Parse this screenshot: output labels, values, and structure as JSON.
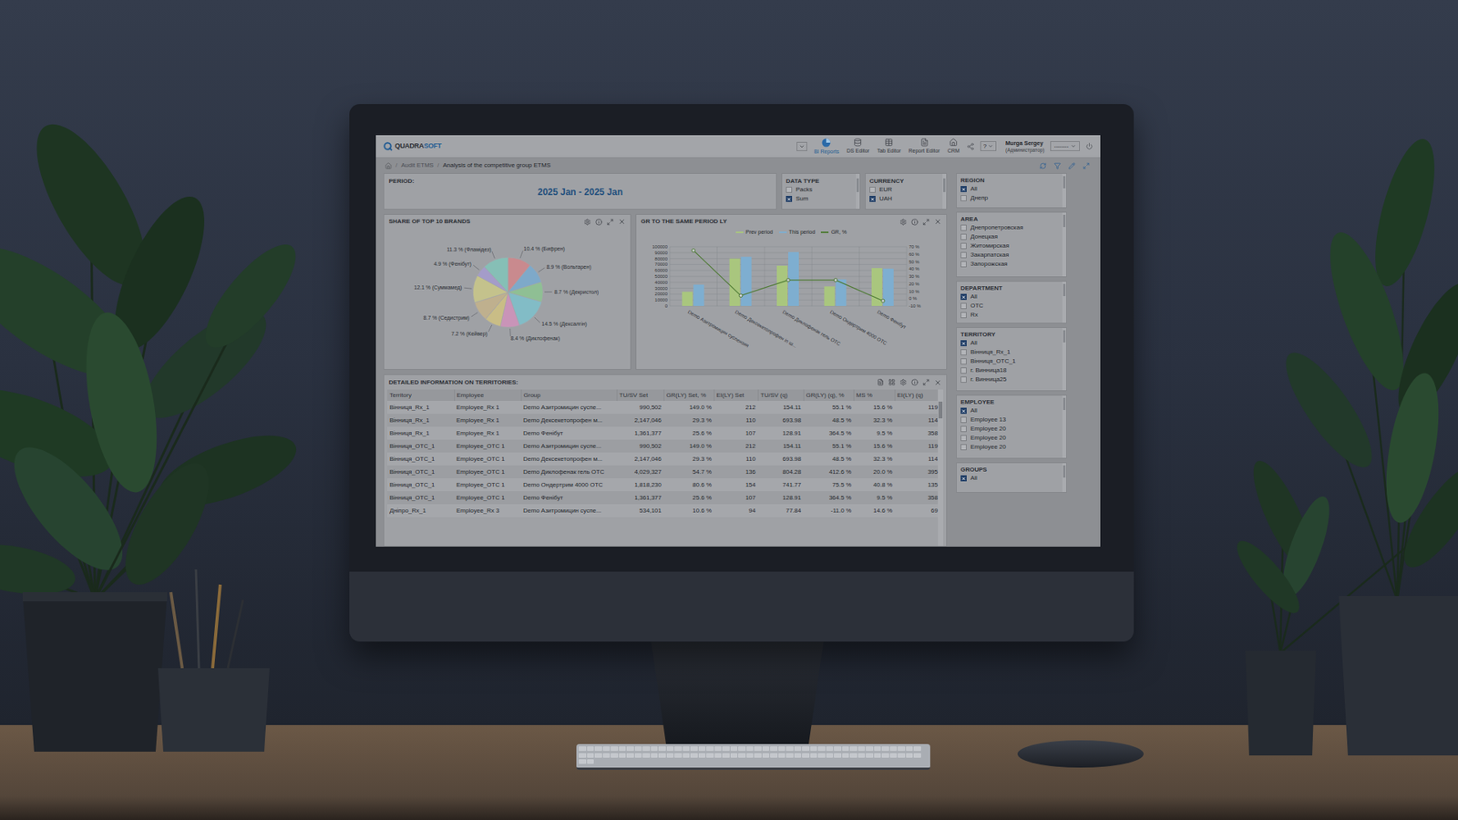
{
  "app": {
    "logo_main": "QUADRA",
    "logo_accent": "SOFT",
    "nav": [
      {
        "label": "BI Reports",
        "selected": true
      },
      {
        "label": "DS Editor",
        "selected": false
      },
      {
        "label": "Tab Editor",
        "selected": false
      },
      {
        "label": "Report Editor",
        "selected": false
      },
      {
        "label": "CRM",
        "selected": false
      }
    ],
    "help": "?",
    "user": {
      "name": "Murga Sergey",
      "role": "(Администратор)"
    },
    "user_select": "--------"
  },
  "breadcrumb": [
    "Audit ETMS",
    "Analysis of the competitive group ETMS"
  ],
  "period": {
    "label": "PERIOD:",
    "value": "2025 Jan - 2025 Jan"
  },
  "data_type": {
    "title": "DATA TYPE",
    "options": [
      {
        "label": "Packs",
        "checked": false
      },
      {
        "label": "Sum",
        "checked": true
      }
    ]
  },
  "currency": {
    "title": "CURRENCY",
    "options": [
      {
        "label": "EUR",
        "checked": false
      },
      {
        "label": "UAH",
        "checked": true
      }
    ]
  },
  "filters": [
    {
      "title": "REGION",
      "items": [
        {
          "label": "All",
          "checked": true
        },
        {
          "label": "Днепр",
          "checked": false
        }
      ]
    },
    {
      "title": "AREA",
      "items": [
        {
          "label": "Днепропетровская",
          "checked": false
        },
        {
          "label": "Донецкая",
          "checked": false
        },
        {
          "label": "Житомирская",
          "checked": false
        },
        {
          "label": "Закарпатская",
          "checked": false
        },
        {
          "label": "Запорожская",
          "checked": false
        }
      ]
    },
    {
      "title": "DEPARTMENT",
      "items": [
        {
          "label": "All",
          "checked": true
        },
        {
          "label": "OTC",
          "checked": false
        },
        {
          "label": "Rx",
          "checked": false
        }
      ]
    },
    {
      "title": "TERRITORY",
      "items": [
        {
          "label": "All",
          "checked": true
        },
        {
          "label": "Вінниця_Rx_1",
          "checked": false
        },
        {
          "label": "Вінниця_OTC_1",
          "checked": false
        },
        {
          "label": "г. Винница18",
          "checked": false
        },
        {
          "label": "г. Винница25",
          "checked": false
        }
      ]
    },
    {
      "title": "EMPLOYEE",
      "items": [
        {
          "label": "All",
          "checked": true
        },
        {
          "label": "Employee 13",
          "checked": false
        },
        {
          "label": "Employee 20",
          "checked": false
        },
        {
          "label": "Employee 20",
          "checked": false
        },
        {
          "label": "Employee 20",
          "checked": false
        }
      ]
    },
    {
      "title": "GROUPS",
      "items": [
        {
          "label": "All",
          "checked": true
        }
      ]
    }
  ],
  "pie": {
    "title": "SHARE OF TOP 10 BRANDS",
    "slices": [
      {
        "label": "10.4 % (Бифрен)",
        "value": 10.4,
        "color": "#c98a8e"
      },
      {
        "label": "8.9 % (Вольтарен)",
        "value": 8.9,
        "color": "#7ea9c9"
      },
      {
        "label": "8.7 % (Декристол)",
        "value": 8.7,
        "color": "#8fbf94"
      },
      {
        "label": "14.5 % (Дексалгін)",
        "value": 14.5,
        "color": "#82bcc6"
      },
      {
        "label": "8.4 % (Диклофенак)",
        "value": 8.4,
        "color": "#c994b8"
      },
      {
        "label": "7.2 % (Кейвер)",
        "value": 7.2,
        "color": "#c9bd86"
      },
      {
        "label": "8.7 % (Седистрим)",
        "value": 8.7,
        "color": "#bfb08e"
      },
      {
        "label": "12.1 % (Суммамед)",
        "value": 12.1,
        "color": "#c4c28c"
      },
      {
        "label": "4.9 % (Фенібут)",
        "value": 4.9,
        "color": "#a49cc9"
      },
      {
        "label": "11.3 % (Фламідез)",
        "value": 11.3,
        "color": "#86bfb6"
      }
    ]
  },
  "bar_chart": {
    "title": "GR TO THE SAME PERIOD LY",
    "y_ticks": [
      "100000",
      "90000",
      "80000",
      "70000",
      "60000",
      "50000",
      "40000",
      "30000",
      "20000",
      "10000",
      "0"
    ],
    "y2_ticks": [
      "70 %",
      "60 %",
      "50 %",
      "40 %",
      "30 %",
      "20 %",
      "10 %",
      "0 %",
      "-10 %"
    ],
    "categories": [
      "Demo Азитромицин суспензия",
      "Demo Дексекетопрофен in ш...",
      "Demo Диклофенак гель OTC",
      "Demo Ондертрим 4000 OTC",
      "Demo Фенібут"
    ],
    "series": [
      {
        "name": "Prev period",
        "kind": "bar",
        "color": "#a9c67e",
        "values": [
          24000,
          80000,
          68000,
          33000,
          64000
        ]
      },
      {
        "name": "This period",
        "kind": "bar",
        "color": "#7eaed0",
        "values": [
          36000,
          83000,
          91000,
          45000,
          63000
        ]
      },
      {
        "name": "GR, %",
        "kind": "line",
        "color": "#4d7a33",
        "values": [
          65,
          4,
          25,
          25,
          -3
        ]
      }
    ]
  },
  "table": {
    "title": "DETAILED INFORMATION ON TERRITORIES:",
    "columns": [
      "Territory",
      "Employee",
      "Group",
      "TU/SV Set",
      "GR(LY) Set, %",
      "EI(LY) Set",
      "TU/SV (q)",
      "GR(LY) (q), %",
      "MS %",
      "EI(LY) (q)"
    ],
    "rows": [
      [
        "Вінниця_Rx_1",
        "Employee_Rx 1",
        "Demo Азитромицин суспе...",
        "990,502",
        "149.0 %",
        "212",
        "154.11",
        "55.1 %",
        "15.6 %",
        "119"
      ],
      [
        "Вінниця_Rx_1",
        "Employee_Rx 1",
        "Demo Дексекетопрофен м...",
        "2,147,046",
        "29.3 %",
        "110",
        "693.98",
        "48.5 %",
        "32.3 %",
        "114"
      ],
      [
        "Вінниця_Rx_1",
        "Employee_Rx 1",
        "Demo Фенібут",
        "1,361,377",
        "25.6 %",
        "107",
        "128.91",
        "364.5 %",
        "9.5 %",
        "358"
      ],
      [
        "Вінниця_OTC_1",
        "Employee_OTC 1",
        "Demo Азитромицин суспе...",
        "990,502",
        "149.0 %",
        "212",
        "154.11",
        "55.1 %",
        "15.6 %",
        "119"
      ],
      [
        "Вінниця_OTC_1",
        "Employee_OTC 1",
        "Demo Дексекетопрофен м...",
        "2,147,046",
        "29.3 %",
        "110",
        "693.98",
        "48.5 %",
        "32.3 %",
        "114"
      ],
      [
        "Вінниця_OTC_1",
        "Employee_OTC 1",
        "Demo Диклофенак гель OTC",
        "4,029,327",
        "54.7 %",
        "136",
        "804.28",
        "412.6 %",
        "20.0 %",
        "395"
      ],
      [
        "Вінниця_OTC_1",
        "Employee_OTC 1",
        "Demo Ондертрим 4000 OTC",
        "1,818,230",
        "80.6 %",
        "154",
        "741.77",
        "75.5 %",
        "40.8 %",
        "135"
      ],
      [
        "Вінниця_OTC_1",
        "Employee_OTC 1",
        "Demo Фенібут",
        "1,361,377",
        "25.6 %",
        "107",
        "128.91",
        "364.5 %",
        "9.5 %",
        "358"
      ],
      [
        "Дніпро_Rx_1",
        "Employee_Rx 3",
        "Demo Азитромицин суспе...",
        "534,101",
        "10.6 %",
        "94",
        "77.84",
        "-11.0 %",
        "14.6 %",
        "69"
      ]
    ]
  }
}
